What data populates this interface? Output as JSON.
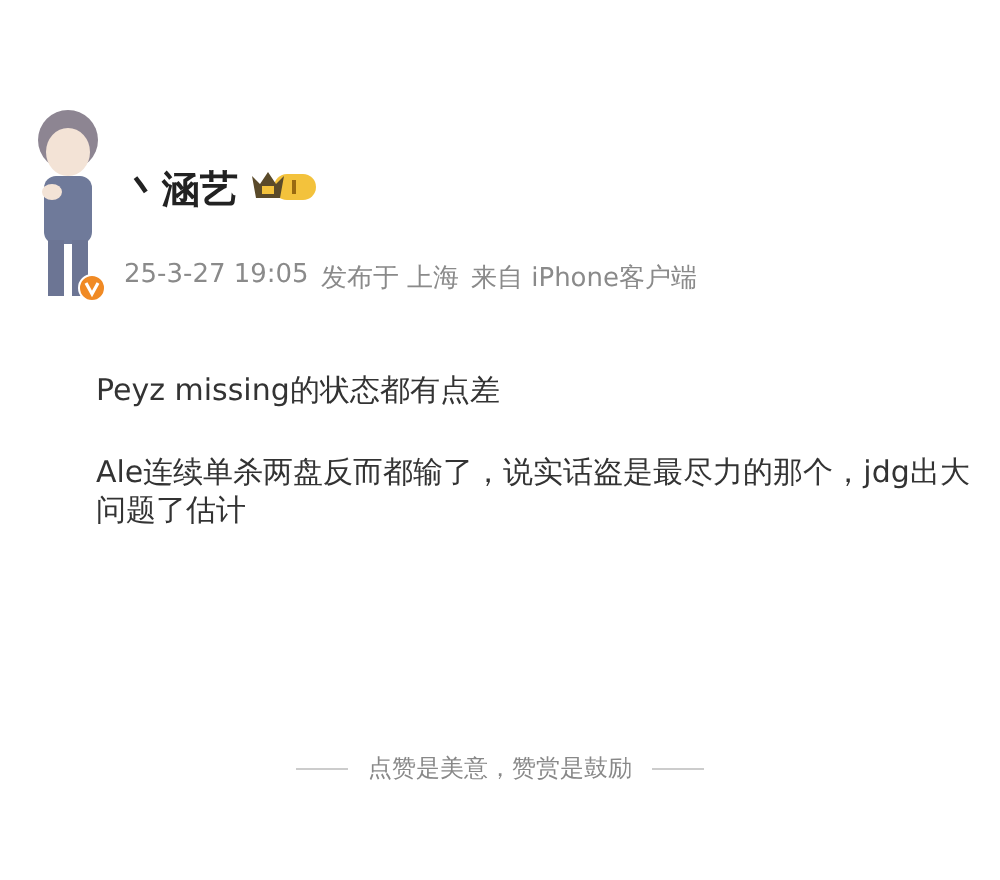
{
  "post": {
    "author": {
      "name": "丶涵艺",
      "verified": true,
      "member_crown": true
    },
    "time": "25-3-27 19:05",
    "location": "发布于 上海",
    "source": "来自 iPhone客户端",
    "paragraphs": [
      "Peyz missing的状态都有点差",
      "Ale连续单杀两盘反而都输了，说实话盗是最尽力的那个，jdg出大问题了估计"
    ]
  },
  "footer": {
    "text": "点赞是美意，赞赏是鼓励"
  }
}
